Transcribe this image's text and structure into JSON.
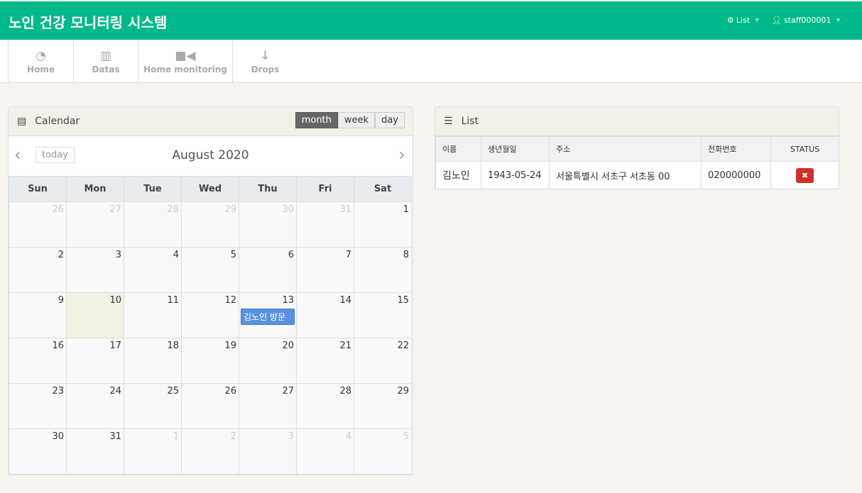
{
  "header": {
    "title": "노인 건강 모니터링 시스템",
    "list_menu": "List",
    "user_menu": "staff000001"
  },
  "nav": [
    {
      "label": "Home",
      "icon": "dashboard-icon"
    },
    {
      "label": "Datas",
      "icon": "bar-chart-icon"
    },
    {
      "label": "Home monitoring",
      "icon": "video-camera-icon"
    },
    {
      "label": "Drops",
      "icon": "arrow-down-icon"
    }
  ],
  "calendar": {
    "title": "Calendar",
    "views": [
      "month",
      "week",
      "day"
    ],
    "active_view": "month",
    "today_label": "today",
    "month_title": "August 2020",
    "weekdays": [
      "Sun",
      "Mon",
      "Tue",
      "Wed",
      "Thu",
      "Fri",
      "Sat"
    ],
    "weeks": [
      [
        "26",
        "27",
        "28",
        "29",
        "30",
        "31",
        "1"
      ],
      [
        "2",
        "3",
        "4",
        "5",
        "6",
        "7",
        "8"
      ],
      [
        "9",
        "10",
        "11",
        "12",
        "13",
        "14",
        "15"
      ],
      [
        "16",
        "17",
        "18",
        "19",
        "20",
        "21",
        "22"
      ],
      [
        "23",
        "24",
        "25",
        "26",
        "27",
        "28",
        "29"
      ],
      [
        "30",
        "31",
        "1",
        "2",
        "3",
        "4",
        "5"
      ]
    ],
    "highlighted_day": "10",
    "events": [
      {
        "day": "13",
        "title": "김노인 방문",
        "color": "#5a92e0"
      }
    ]
  },
  "list": {
    "title": "List",
    "columns": [
      "이름",
      "생년월일",
      "주소",
      "전화번호",
      "STATUS"
    ],
    "rows": [
      {
        "name": "김노인",
        "birth": "1943-05-24",
        "address": "서울특별시 서초구 서초동 00",
        "phone": "020000000",
        "status_action": "✖"
      }
    ]
  },
  "colors": {
    "brand": "#00b98a",
    "danger": "#d0302a",
    "event": "#5a92e0"
  }
}
